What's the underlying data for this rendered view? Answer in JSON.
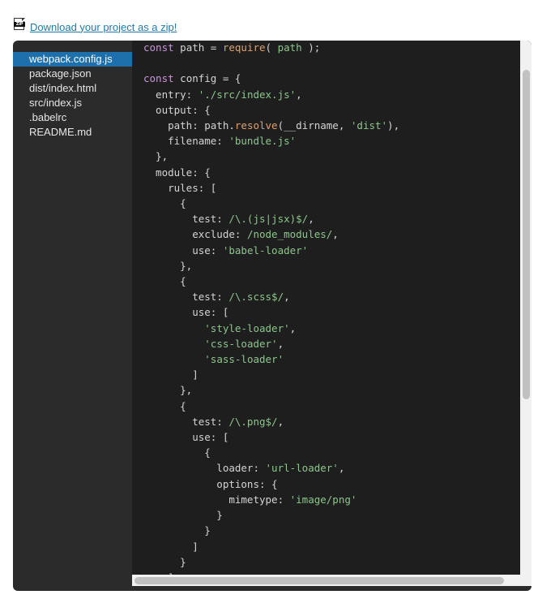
{
  "download": {
    "icon": "zip-file-icon",
    "icon_label": "ZIP",
    "link_text": "Download your project as a zip!"
  },
  "files": [
    {
      "name": "webpack.config.js",
      "active": true
    },
    {
      "name": "package.json",
      "active": false
    },
    {
      "name": "dist/index.html",
      "active": false
    },
    {
      "name": "src/index.js",
      "active": false
    },
    {
      "name": ".babelrc",
      "active": false
    },
    {
      "name": "README.md",
      "active": false
    }
  ],
  "editor": {
    "lines": [
      [
        [
          "k",
          "const"
        ],
        [
          "p",
          " path = "
        ],
        [
          "f",
          "require"
        ],
        [
          "p",
          "( "
        ],
        [
          "s",
          "path"
        ],
        [
          "p",
          " );"
        ]
      ],
      [],
      [
        [
          "k",
          "const"
        ],
        [
          "p",
          " config = {"
        ]
      ],
      [
        [
          "p",
          "  entry: "
        ],
        [
          "s",
          "'./src/index.js'"
        ],
        [
          "p",
          ","
        ]
      ],
      [
        [
          "p",
          "  output: {"
        ]
      ],
      [
        [
          "p",
          "    path: path."
        ],
        [
          "f",
          "resolve"
        ],
        [
          "p",
          "(__dirname, "
        ],
        [
          "s",
          "'dist'"
        ],
        [
          "p",
          "),"
        ]
      ],
      [
        [
          "p",
          "    filename: "
        ],
        [
          "s",
          "'bundle.js'"
        ]
      ],
      [
        [
          "p",
          "  },"
        ]
      ],
      [
        [
          "p",
          "  module: {"
        ]
      ],
      [
        [
          "p",
          "    rules: ["
        ]
      ],
      [
        [
          "p",
          "      {"
        ]
      ],
      [
        [
          "p",
          "        test: "
        ],
        [
          "s",
          "/\\.(js|jsx)$/"
        ],
        [
          "p",
          ","
        ]
      ],
      [
        [
          "p",
          "        exclude: "
        ],
        [
          "s",
          "/node_modules/"
        ],
        [
          "p",
          ","
        ]
      ],
      [
        [
          "p",
          "        use: "
        ],
        [
          "s",
          "'babel-loader'"
        ]
      ],
      [
        [
          "p",
          "      },"
        ]
      ],
      [
        [
          "p",
          "      {"
        ]
      ],
      [
        [
          "p",
          "        test: "
        ],
        [
          "s",
          "/\\.scss$/"
        ],
        [
          "p",
          ","
        ]
      ],
      [
        [
          "p",
          "        use: ["
        ]
      ],
      [
        [
          "p",
          "          "
        ],
        [
          "s",
          "'style-loader'"
        ],
        [
          "p",
          ","
        ]
      ],
      [
        [
          "p",
          "          "
        ],
        [
          "s",
          "'css-loader'"
        ],
        [
          "p",
          ","
        ]
      ],
      [
        [
          "p",
          "          "
        ],
        [
          "s",
          "'sass-loader'"
        ]
      ],
      [
        [
          "p",
          "        ]"
        ]
      ],
      [
        [
          "p",
          "      },"
        ]
      ],
      [
        [
          "p",
          "      {"
        ]
      ],
      [
        [
          "p",
          "        test: "
        ],
        [
          "s",
          "/\\.png$/"
        ],
        [
          "p",
          ","
        ]
      ],
      [
        [
          "p",
          "        use: ["
        ]
      ],
      [
        [
          "p",
          "          {"
        ]
      ],
      [
        [
          "p",
          "            loader: "
        ],
        [
          "s",
          "'url-loader'"
        ],
        [
          "p",
          ","
        ]
      ],
      [
        [
          "p",
          "            options: {"
        ]
      ],
      [
        [
          "p",
          "              mimetype: "
        ],
        [
          "s",
          "'image/png'"
        ]
      ],
      [
        [
          "p",
          "            }"
        ]
      ],
      [
        [
          "p",
          "          }"
        ]
      ],
      [
        [
          "p",
          "        ]"
        ]
      ],
      [
        [
          "p",
          "      }"
        ]
      ],
      [
        [
          "p",
          "    ]"
        ]
      ]
    ]
  },
  "colors": {
    "panel": "#2b2b2b",
    "editor": "#1e1e1e",
    "active_file": "#1e70ad",
    "link": "#1f7aa8",
    "keyword": "#c994d9",
    "string": "#8cc68c",
    "function": "#e0a070"
  }
}
